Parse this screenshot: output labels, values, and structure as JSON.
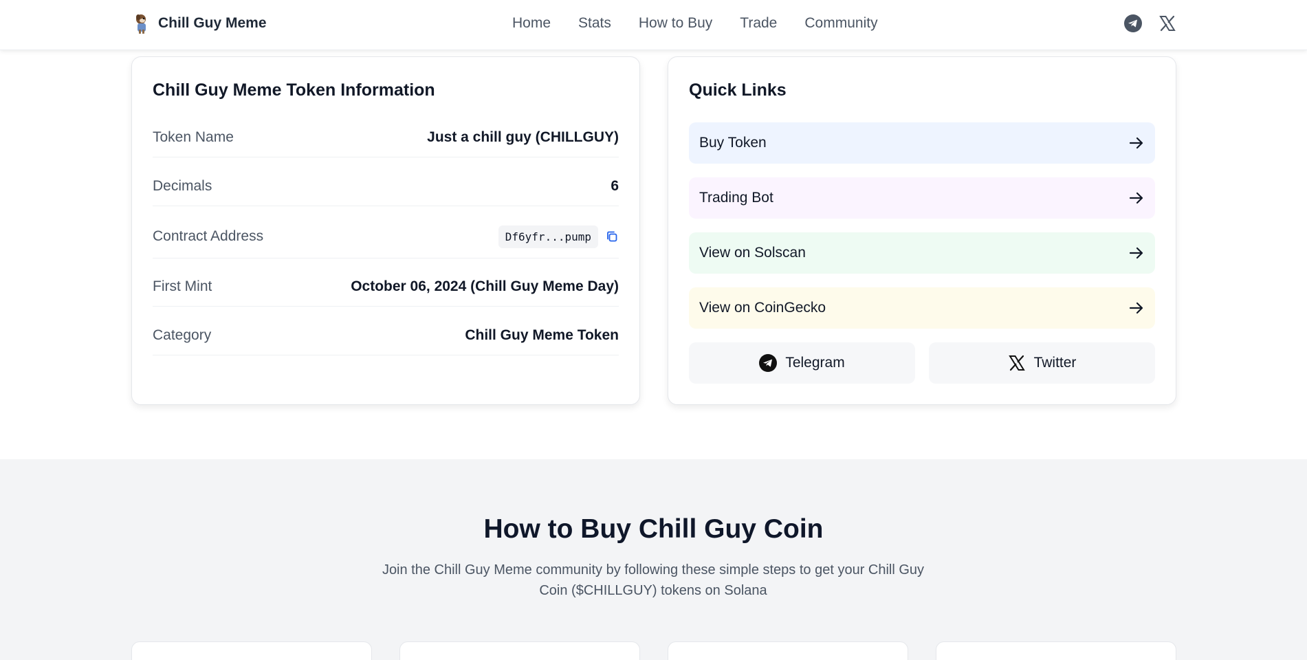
{
  "header": {
    "brand": "Chill Guy Meme",
    "logo_icon": "chill-guy-dog-logo",
    "nav": [
      "Home",
      "Stats",
      "How to Buy",
      "Trade",
      "Community"
    ],
    "social_icons": [
      "telegram-icon",
      "x-icon"
    ]
  },
  "info_card": {
    "title": "Chill Guy Meme Token Information",
    "rows": [
      {
        "label": "Token Name",
        "value": "Just a chill guy (CHILLGUY)"
      },
      {
        "label": "Decimals",
        "value": "6"
      },
      {
        "label": "Contract Address",
        "value": "Df6yfr...pump"
      },
      {
        "label": "First Mint",
        "value": "October 06, 2024 (Chill Guy Meme Day)"
      },
      {
        "label": "Category",
        "value": "Chill Guy Meme Token"
      }
    ]
  },
  "quick_links": {
    "title": "Quick Links",
    "items": [
      {
        "label": "Buy Token",
        "bg": "#eef4ff"
      },
      {
        "label": "Trading Bot",
        "bg": "#fbf4ff"
      },
      {
        "label": "View on Solscan",
        "bg": "#eefbf3"
      },
      {
        "label": "View on CoinGecko",
        "bg": "#fefbeb"
      }
    ],
    "social": [
      {
        "label": "Telegram",
        "icon": "telegram-icon"
      },
      {
        "label": "Twitter",
        "icon": "x-icon"
      }
    ]
  },
  "how_to_buy": {
    "title": "How to Buy Chill Guy Coin",
    "subtitle": "Join the Chill Guy Meme community by following these simple steps to get your Chill Guy Coin ($CHILLGUY) tokens on Solana"
  },
  "colors": {
    "accent_blue": "#2563eb",
    "text_dark": "#111827",
    "text_muted": "#4b5563",
    "section_bg": "#f3f4f6"
  }
}
